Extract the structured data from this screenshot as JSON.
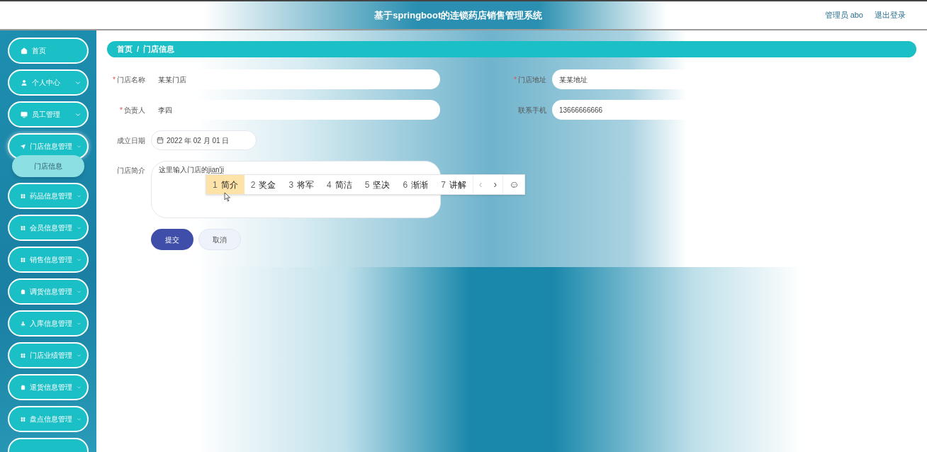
{
  "header": {
    "title": "基于springboot的连锁药店销售管理系统",
    "user": "管理员 abo",
    "logout": "退出登录"
  },
  "sidebar": {
    "items": [
      {
        "label": "首页",
        "expandable": false,
        "expanded": false
      },
      {
        "label": "个人中心",
        "expandable": true,
        "expanded": false
      },
      {
        "label": "员工管理",
        "expandable": true,
        "expanded": false
      },
      {
        "label": "门店信息管理",
        "expandable": true,
        "expanded": true,
        "children": [
          {
            "label": "门店信息",
            "selected": true
          }
        ]
      },
      {
        "label": "药品信息管理",
        "expandable": true,
        "expanded": false
      },
      {
        "label": "会员信息管理",
        "expandable": true,
        "expanded": false
      },
      {
        "label": "销售信息管理",
        "expandable": true,
        "expanded": false
      },
      {
        "label": "调货信息管理",
        "expandable": true,
        "expanded": false
      },
      {
        "label": "入库信息管理",
        "expandable": true,
        "expanded": false
      },
      {
        "label": "门店业绩管理",
        "expandable": true,
        "expanded": false
      },
      {
        "label": "退货信息管理",
        "expandable": true,
        "expanded": false
      },
      {
        "label": "盘点信息管理",
        "expandable": true,
        "expanded": false
      }
    ]
  },
  "breadcrumb": {
    "separator": "/",
    "items": [
      "首页",
      "门店信息"
    ]
  },
  "form": {
    "required_mark": "*",
    "rows": [
      [
        {
          "label": "门店名称",
          "required": true,
          "value": "某某门店"
        },
        {
          "label": "门店地址",
          "required": true,
          "value": "某某地址"
        }
      ],
      [
        {
          "label": "负责人",
          "required": true,
          "value": "李四"
        },
        {
          "label": "联系手机",
          "required": false,
          "value": "13666666666"
        }
      ]
    ],
    "date": {
      "label": "成立日期",
      "value": "2022 年 02 月 01 日"
    },
    "intro": {
      "label": "门店简介",
      "value": "这里输入门店的",
      "composing": "jian'ji"
    },
    "buttons": [
      {
        "label": "提交",
        "kind": "primary"
      },
      {
        "label": "取消",
        "kind": "secondary"
      }
    ]
  },
  "ime": {
    "candidates": [
      {
        "number": "1",
        "word": "简介",
        "selected": true
      },
      {
        "number": "2",
        "word": "奖金",
        "selected": false
      },
      {
        "number": "3",
        "word": "将军",
        "selected": false
      },
      {
        "number": "4",
        "word": "简洁",
        "selected": false
      },
      {
        "number": "5",
        "word": "坚决",
        "selected": false
      },
      {
        "number": "6",
        "word": "渐渐",
        "selected": false
      },
      {
        "number": "7",
        "word": "讲解",
        "selected": false
      }
    ],
    "prev": "‹",
    "next": "›",
    "emoji": "☺"
  }
}
